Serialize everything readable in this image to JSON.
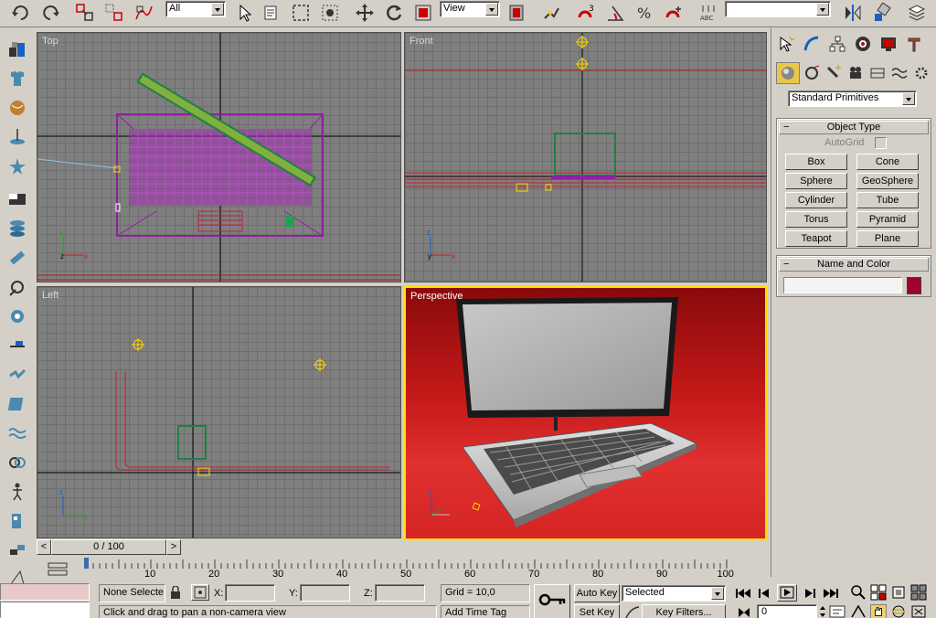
{
  "toolbar": {
    "selection_filter": "All",
    "reference_coord": "View",
    "named_selection": ""
  },
  "viewports": {
    "top": "Top",
    "front": "Front",
    "left": "Left",
    "perspective": "Perspective"
  },
  "command_panel": {
    "category": "Standard Primitives",
    "object_type_title": "Object Type",
    "autogrid_label": "AutoGrid",
    "buttons": [
      "Box",
      "Cone",
      "Sphere",
      "GeoSphere",
      "Cylinder",
      "Tube",
      "Torus",
      "Pyramid",
      "Teapot",
      "Plane"
    ],
    "name_color_title": "Name and Color",
    "name_value": "",
    "object_color": "#a00030"
  },
  "timeline": {
    "frame_label": "0 / 100",
    "current_frame": 0,
    "total_frames": 100,
    "ticks": [
      "10",
      "20",
      "30",
      "40",
      "50",
      "60",
      "70",
      "80",
      "90",
      "100"
    ]
  },
  "status": {
    "selection": "None Selecte",
    "x_label": "X:",
    "y_label": "Y:",
    "z_label": "Z:",
    "grid": "Grid = 10,0",
    "prompt": "Click and drag to pan a non-camera view",
    "add_time_tag": "Add Time Tag",
    "auto_key": "Auto Key",
    "set_key": "Set Key",
    "key_mode": "Selected",
    "key_filters": "Key Filters...",
    "frame_value": "0"
  }
}
